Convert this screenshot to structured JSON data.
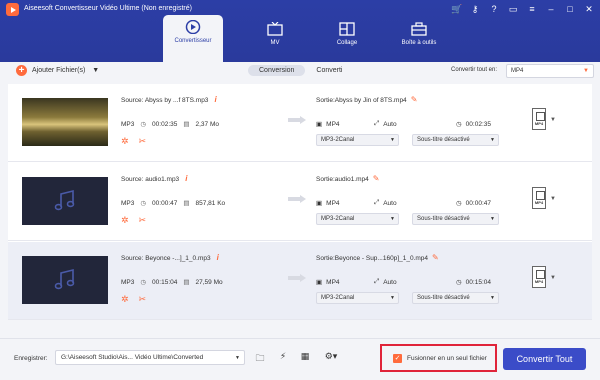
{
  "window": {
    "title": "Aiseesoft Convertisseur Vidéo Ultime (Non enregistré)",
    "controls": [
      "cart-icon",
      "key-icon",
      "help-icon",
      "chat-icon",
      "menu-icon",
      "minimize-icon",
      "maximize-icon",
      "close-icon"
    ]
  },
  "tabs": [
    {
      "label": "Convertisseur",
      "icon": "convert-icon",
      "active": true
    },
    {
      "label": "MV",
      "icon": "tv-icon"
    },
    {
      "label": "Collage",
      "icon": "collage-icon"
    },
    {
      "label": "Boîte à outils",
      "icon": "toolbox-icon"
    }
  ],
  "toolbar": {
    "add_label": "Ajouter Fichier(s)",
    "seg_conversion": "Conversion",
    "seg_converti": "Converti",
    "convert_all_label": "Convertir tout en:",
    "convert_all_value": "MP4"
  },
  "files": [
    {
      "source": "Source: Abyss by ...f 8TS.mp3",
      "format": "MP3",
      "duration": "00:02:35",
      "size": "2,37 Mo",
      "output": "Sortie:Abyss by Jin of 8TS.mp4",
      "out_format": "MP4",
      "out_res": "Auto",
      "out_duration": "00:02:35",
      "audio": "MP3-2Canal",
      "subtitle": "Sous-titre désactivé",
      "badge": "MP4"
    },
    {
      "source": "Source: audio1.mp3",
      "format": "MP3",
      "duration": "00:00:47",
      "size": "857,81 Ko",
      "output": "Sortie:audio1.mp4",
      "out_format": "MP4",
      "out_res": "Auto",
      "out_duration": "00:00:47",
      "audio": "MP3-2Canal",
      "subtitle": "Sous-titre désactivé",
      "badge": "MP4"
    },
    {
      "source": "Source: Beyonce -...]_1_0.mp3",
      "format": "MP3",
      "duration": "00:15:04",
      "size": "27,59 Mo",
      "output": "Sortie:Beyonce - Sup...160p]_1_0.mp4",
      "out_format": "MP4",
      "out_res": "Auto",
      "out_duration": "00:15:04",
      "audio": "MP3-2Canal",
      "subtitle": "Sous-titre désactivé",
      "badge": "MP4"
    }
  ],
  "bottom": {
    "save_label": "Enregistrer:",
    "path": "G:\\Aiseesoft Studio\\Ais... Vidéo Ultime\\Converted",
    "merge_label": "Fusionner en un seul fichier",
    "merge_checked": true,
    "convert_button": "Convertir Tout"
  },
  "colors": {
    "header": "#2c3ea6",
    "accent": "#ff6b3d",
    "button": "#3b4cc8",
    "highlight_border": "#e0243a"
  }
}
